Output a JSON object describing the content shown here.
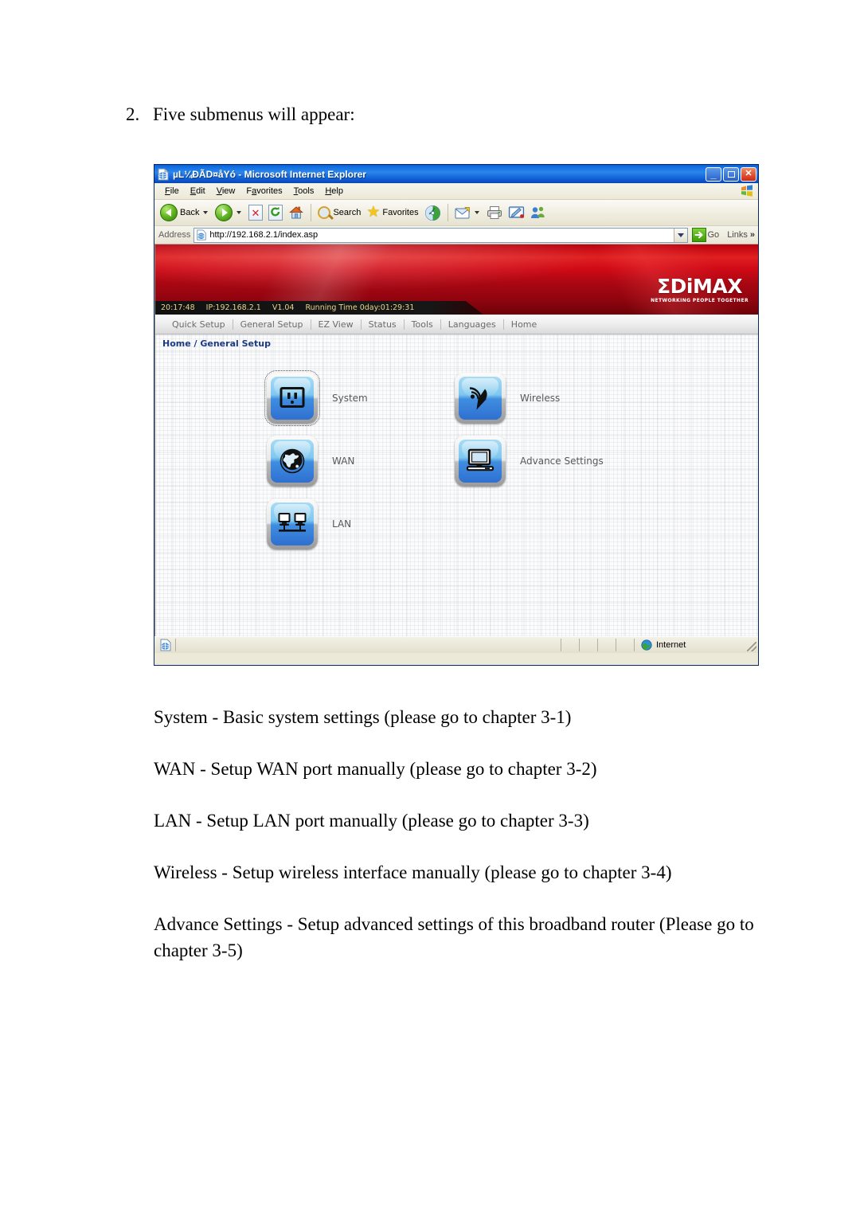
{
  "document": {
    "step_number": "2.",
    "step_text": "Five submenus will appear:",
    "paragraphs": [
      "System - Basic system settings (please go to chapter 3-1)",
      "WAN - Setup WAN port manually (please go to chapter 3-2)",
      "LAN - Setup LAN port manually (please go to chapter 3-3)",
      "Wireless - Setup wireless interface manually (please go to chapter 3-4)",
      "Advance Settings - Setup advanced settings of this broadband router (Please go to chapter 3-5)"
    ]
  },
  "browser": {
    "title": "µL¼ÐÃD¤åYó - Microsoft Internet Explorer",
    "title_icon": "ie-page-icon",
    "window_controls": {
      "minimize": "minimize-icon",
      "maximize": "maximize-icon",
      "close": "close-icon"
    },
    "menu": [
      {
        "label": "File",
        "accel": "F"
      },
      {
        "label": "Edit",
        "accel": "E"
      },
      {
        "label": "View",
        "accel": "V"
      },
      {
        "label": "Favorites",
        "accel": "a"
      },
      {
        "label": "Tools",
        "accel": "T"
      },
      {
        "label": "Help",
        "accel": "H"
      }
    ],
    "toolbar": {
      "back_label": "Back",
      "back_icon": "back-arrow-icon",
      "forward_icon": "forward-arrow-icon",
      "stop_icon": "stop-icon",
      "refresh_icon": "refresh-icon",
      "home_icon": "home-icon",
      "search_label": "Search",
      "search_icon": "search-icon",
      "favorites_label": "Favorites",
      "favorites_icon": "star-icon",
      "history_icon": "history-icon",
      "mail_icon": "mail-icon",
      "print_icon": "print-icon",
      "edit_icon": "edit-icon",
      "messenger_icon": "messenger-icon"
    },
    "address": {
      "label": "Address",
      "url": "http://192.168.2.1/index.asp",
      "site_icon": "ie-page-icon",
      "dropdown_icon": "chevron-down-icon",
      "go_label": "Go",
      "go_icon": "go-arrow-icon",
      "links_label": "Links",
      "overflow_icon": "chevron-double-right-icon"
    },
    "statusbar": {
      "page_icon": "ie-page-icon",
      "zone_label": "Internet",
      "zone_icon": "globe-icon",
      "resize_grip": "resize-grip-icon"
    }
  },
  "router": {
    "logo": {
      "sigma": "Σ",
      "name": "DiMAX",
      "tagline": "NETWORKING PEOPLE TOGETHER"
    },
    "status": {
      "time": "20:17:48",
      "ip": "IP:192.168.2.1",
      "version": "V1.04",
      "running_time": "Running Time 0day:01:29:31"
    },
    "nav": [
      "Quick Setup",
      "General Setup",
      "EZ View",
      "Status",
      "Tools",
      "Languages",
      "Home"
    ],
    "breadcrumb": "Home / General Setup",
    "menu_left": [
      {
        "label": "System",
        "icon": "power-outlet-icon",
        "focused": true
      },
      {
        "label": "WAN",
        "icon": "globe-icon",
        "focused": false
      },
      {
        "label": "LAN",
        "icon": "two-computers-icon",
        "focused": false
      }
    ],
    "menu_right": [
      {
        "label": "Wireless",
        "icon": "satellite-dish-icon",
        "focused": false
      },
      {
        "label": "Advance Settings",
        "icon": "computer-monitor-icon",
        "focused": false
      }
    ]
  },
  "colors": {
    "banner_red": "#cf0a16",
    "title_blue": "#2b86ec",
    "breadcrumb_blue": "#1b3a86",
    "status_text": "#e8d58a",
    "tile_blue": "#3f8ee0"
  }
}
